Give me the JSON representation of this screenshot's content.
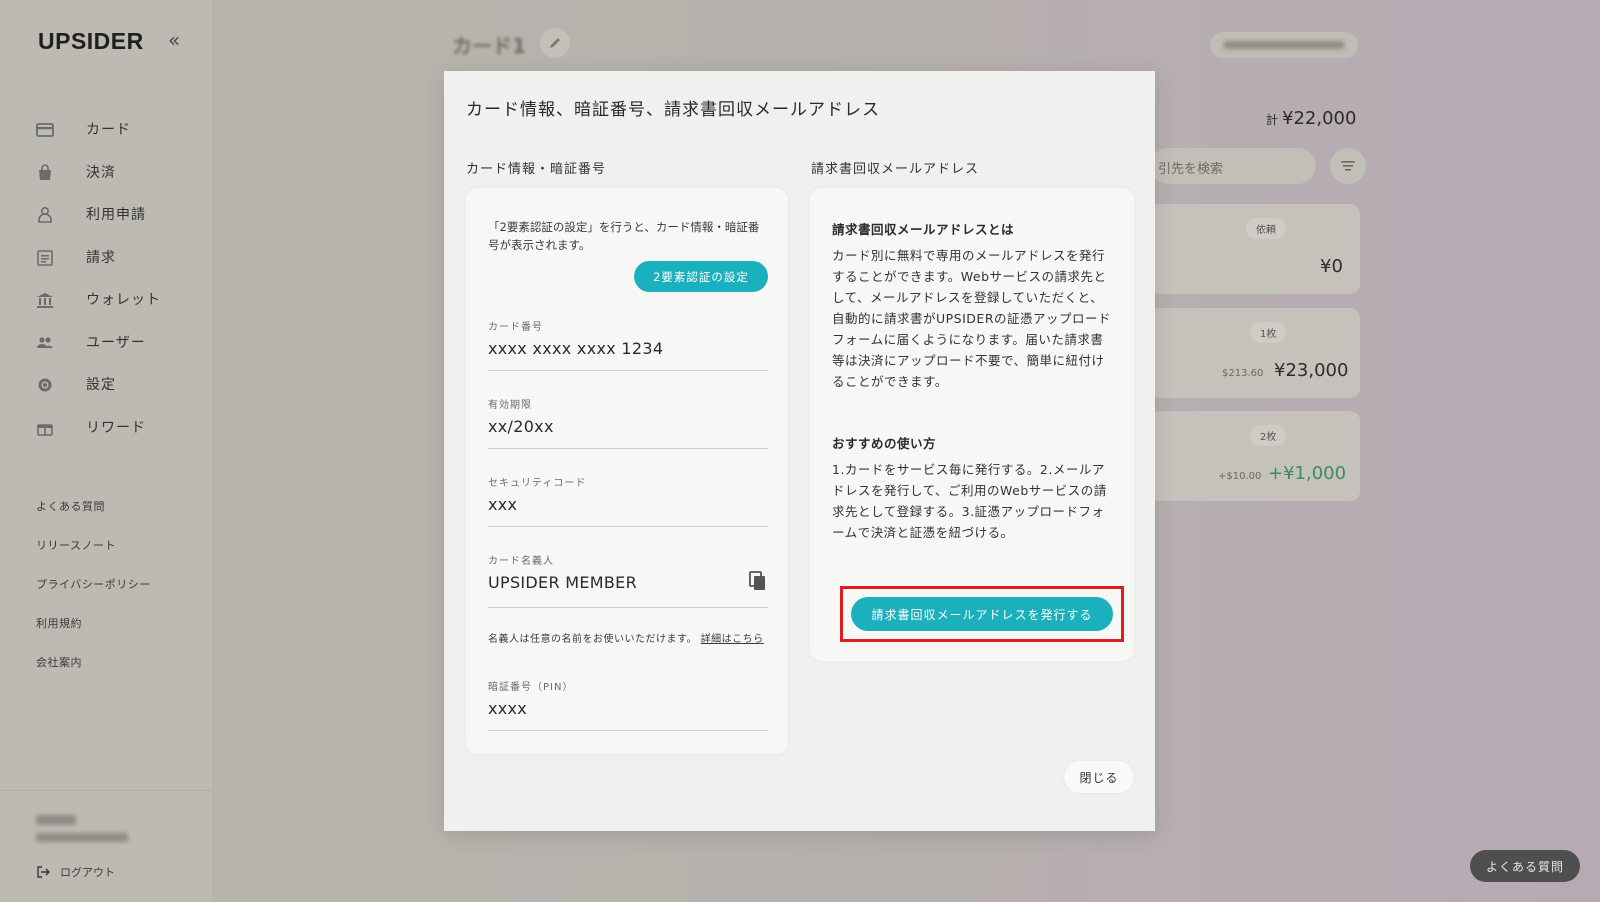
{
  "sidebar": {
    "logo": "UPSIDER",
    "collapse_icon": "«",
    "nav": [
      {
        "label": "カード",
        "icon": "card-icon"
      },
      {
        "label": "決済",
        "icon": "bag-icon"
      },
      {
        "label": "利用申請",
        "icon": "user-request-icon"
      },
      {
        "label": "請求",
        "icon": "invoice-icon"
      },
      {
        "label": "ウォレット",
        "icon": "bank-icon"
      },
      {
        "label": "ユーザー",
        "icon": "users-icon"
      },
      {
        "label": "設定",
        "icon": "gear-icon"
      },
      {
        "label": "リワード",
        "icon": "gift-icon"
      }
    ],
    "links": [
      "よくある質問",
      "リリースノート",
      "プライバシーポリシー",
      "利用規約",
      "会社案内"
    ],
    "logout": "ログアウト"
  },
  "background": {
    "card_title": "カード1",
    "total": "¥22,000",
    "total_prefix": "計",
    "search_placeholder": "引先を検索",
    "cards": [
      {
        "pill": "依頼",
        "amount": "¥0",
        "sub": ""
      },
      {
        "pill": "1枚",
        "amount": "¥23,000",
        "sub": "$213.60"
      },
      {
        "pill": "2枚",
        "amount": "+¥1,000",
        "sub": "+$10.00"
      }
    ],
    "faq_button": "よくある質問"
  },
  "modal": {
    "title": "カード情報、暗証番号、請求書回収メールアドレス",
    "left_section_title": "カード情報・暗証番号",
    "right_section_title": "請求書回収メールアドレス",
    "notice": "「2要素認証の設定」を行うと、カード情報・暗証番号が表示されます。",
    "twofa_button": "2要素認証の設定",
    "fields": {
      "card_number_label": "カード番号",
      "card_number": "xxxx xxxx xxxx 1234",
      "expiry_label": "有効期限",
      "expiry": "xx/20xx",
      "cvc_label": "セキュリティコード",
      "cvc": "xxx",
      "holder_label": "カード名義人",
      "holder": "UPSIDER MEMBER",
      "pin_label": "暗証番号（PIN）",
      "pin": "xxxx"
    },
    "holder_note": "名義人は任意の名前をお使いいただけます。",
    "holder_note_link": "詳細はこちら",
    "about_heading": "請求書回収メールアドレスとは",
    "about_text": "カード別に無料で専用のメールアドレスを発行することができます。Webサービスの請求先として、メールアドレスを登録していただくと、自動的に請求書がUPSIDERの証憑アップロードフォームに届くようになります。届いた請求書等は決済にアップロード不要で、簡単に紐付けることができます。",
    "usage_heading": "おすすめの使い方",
    "usage_text": "1.カードをサービス毎に発行する。2.メールアドレスを発行して、ご利用のWebサービスの請求先として登録する。3.証憑アップロードフォームで決済と証憑を紐づける。",
    "issue_button": "請求書回収メールアドレスを発行する",
    "close_button": "閉じる"
  },
  "colors": {
    "accent": "#1bb0bd",
    "highlight": "#e01c1c"
  }
}
